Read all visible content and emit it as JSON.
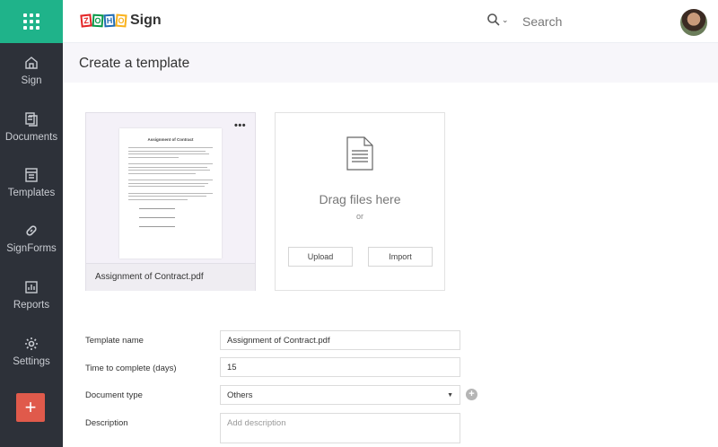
{
  "sidebar": {
    "items": [
      {
        "label": "Sign",
        "icon": "home-icon"
      },
      {
        "label": "Documents",
        "icon": "documents-icon"
      },
      {
        "label": "Templates",
        "icon": "templates-icon"
      },
      {
        "label": "SignForms",
        "icon": "link-icon"
      },
      {
        "label": "Reports",
        "icon": "reports-icon"
      },
      {
        "label": "Settings",
        "icon": "gear-icon"
      }
    ],
    "add_label": "+"
  },
  "header": {
    "logo_letters": [
      "Z",
      "O",
      "H",
      "O"
    ],
    "logo_colors": [
      "#e42527",
      "#089949",
      "#226db4",
      "#f9b21d"
    ],
    "logo_text": "Sign",
    "search_placeholder": "Search"
  },
  "page": {
    "title": "Create a template"
  },
  "document": {
    "preview_heading": "Assignment of Contract",
    "file_name": "Assignment of Contract.pdf",
    "more_label": "•••"
  },
  "upload": {
    "drag_text": "Drag files here",
    "or_text": "or",
    "upload_label": "Upload",
    "import_label": "Import"
  },
  "form": {
    "template_name_label": "Template name",
    "template_name_value": "Assignment of Contract.pdf",
    "time_label": "Time to complete (days)",
    "time_value": "15",
    "doc_type_label": "Document type",
    "doc_type_value": "Others",
    "description_label": "Description",
    "description_placeholder": "Add description"
  },
  "colors": {
    "accent": "#1fb38a",
    "sidebar_bg": "#2d3139",
    "add_button": "#e05a4b"
  }
}
